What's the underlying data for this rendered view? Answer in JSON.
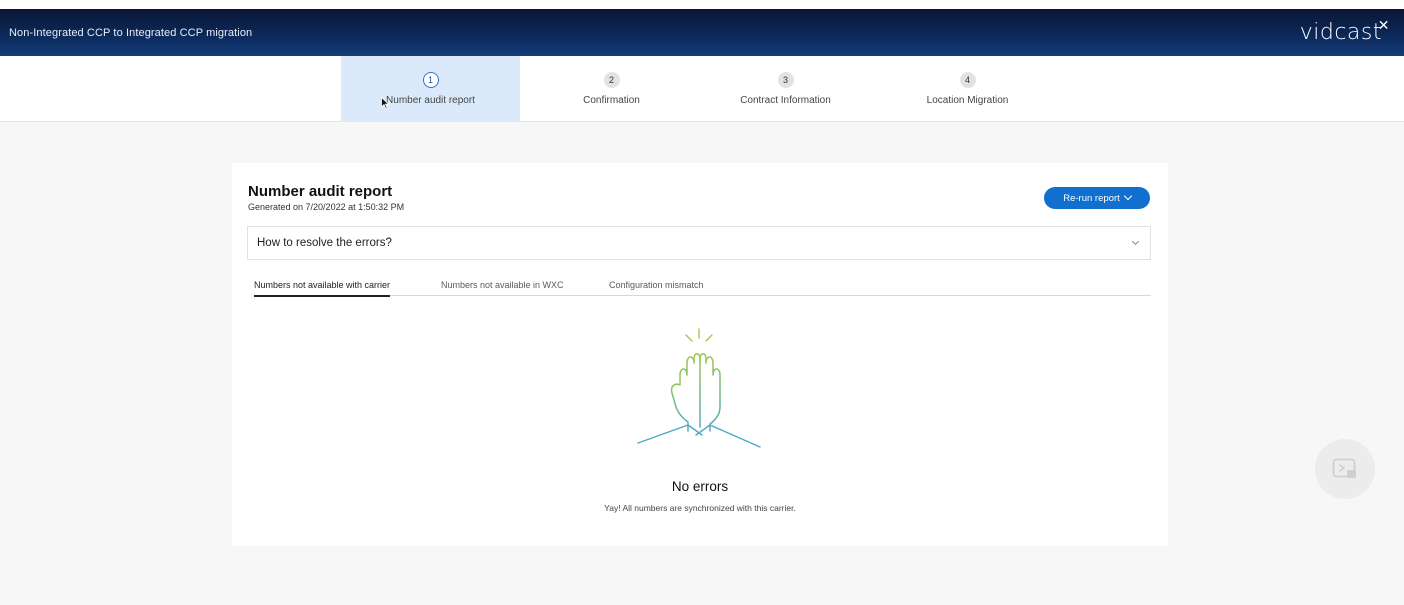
{
  "header": {
    "title": "Non-Integrated CCP to Integrated CCP migration",
    "brand": "vidcast"
  },
  "stepper": {
    "steps": [
      {
        "number": "1",
        "label": "Number audit report",
        "active": true
      },
      {
        "number": "2",
        "label": "Confirmation",
        "active": false
      },
      {
        "number": "3",
        "label": "Contract Information",
        "active": false
      },
      {
        "number": "4",
        "label": "Location Migration",
        "active": false
      }
    ]
  },
  "report": {
    "title": "Number audit report",
    "generated": "Generated on 7/20/2022 at 1:50:32 PM",
    "rerun_label": "Re-run report",
    "accordion_label": "How to resolve the errors?",
    "tabs": [
      {
        "label": "Numbers not available with carrier",
        "active": true
      },
      {
        "label": "Numbers not available in WXC",
        "active": false
      },
      {
        "label": "Configuration mismatch",
        "active": false
      }
    ],
    "empty_title": "No errors",
    "empty_message": "Yay! All numbers are synchronized with this carrier."
  },
  "icons": {
    "empty_state": "high-five-icon",
    "floating": "screen-share-icon",
    "close": "close-icon"
  },
  "colors": {
    "header_bg": "#0c2a5c",
    "accent": "#1170cf",
    "active_step_bg": "#dbeafa",
    "illus_green": "#9ec94a",
    "illus_teal": "#4fa9c2"
  }
}
